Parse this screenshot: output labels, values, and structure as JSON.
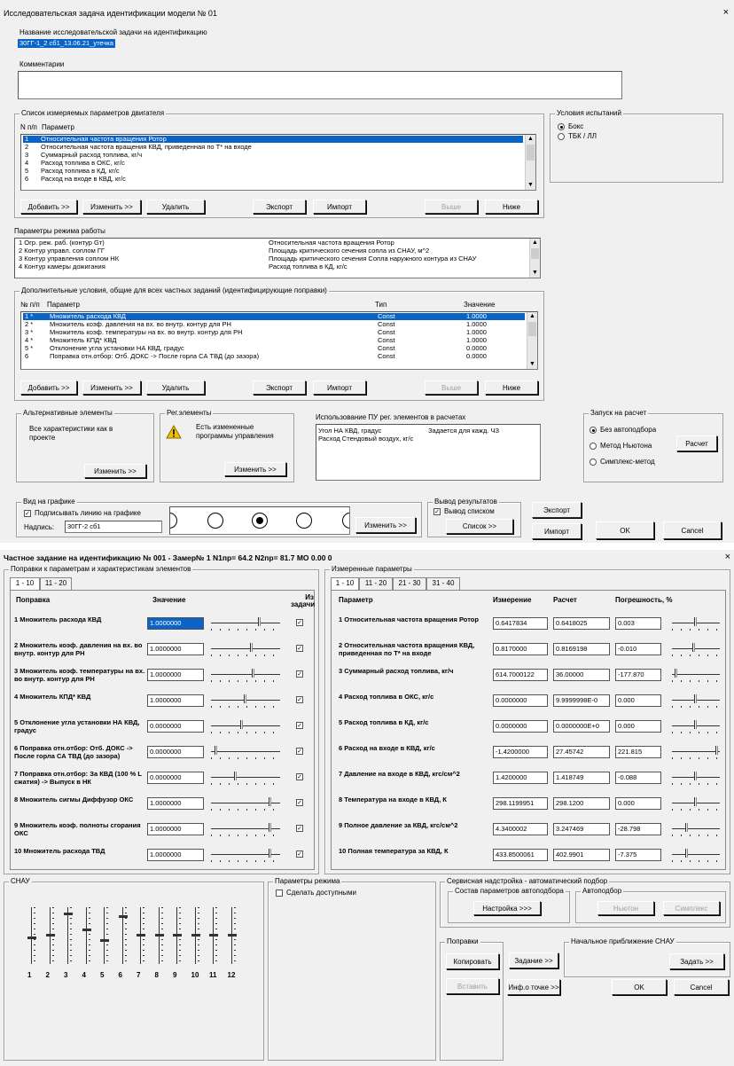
{
  "win1": {
    "title": "Исследовательская задача идентификации модели № 01",
    "close": "×",
    "name_label": "Название исследовательской задачи на идентификацию",
    "name_value": "30ГГ-1_2 сб1_13.06.21_утечка",
    "comment_label": "Комментарии",
    "params_group": "Список измеряемых параметров двигателя",
    "col_num": "N п/п",
    "col_param": "Параметр",
    "params": [
      {
        "n": "1",
        "t": "Относительная частота вращения Ротор"
      },
      {
        "n": "2",
        "t": "Относительная частота вращения КВД, приведенная по Т* на входе"
      },
      {
        "n": "3",
        "t": "Суммарный расход топлива, кг/ч"
      },
      {
        "n": "4",
        "t": "Расход топлива в ОКС, кг/с"
      },
      {
        "n": "5",
        "t": "Расход топлива в КД, кг/с"
      },
      {
        "n": "6",
        "t": "Расход на входе в КВД, кг/с"
      }
    ],
    "btn_add": "Добавить >>",
    "btn_change": "Изменить >>",
    "btn_delete": "Удалить",
    "btn_export": "Экспорт",
    "btn_import": "Импорт",
    "btn_up": "Выше",
    "btn_down": "Ниже",
    "cond_group": "Условия испытаний",
    "cond_box": "Бокс",
    "cond_tbk": "ТБК / ЛЛ",
    "mode_label": "Параметры режима работы",
    "mode_rows": [
      {
        "a": "1  Огр. реж. раб. (контур Gт)",
        "b": "Относительная частота вращения Ротор"
      },
      {
        "a": "2  Контур управл. соплом ГГ",
        "b": "Площадь критического сечения сопла из СНАУ, м^2"
      },
      {
        "a": "3  Контур управления соплом НК",
        "b": "Площадь критического сечения Сопла наружного контура из СНАУ"
      },
      {
        "a": "4  Контур камеры дожигания",
        "b": "Расход топлива в КД, кг/с"
      }
    ],
    "add_group": "Дополнительные условия, общие для всех частных заданий (идентифицирующие поправки)",
    "add_col_num": "№ п/п",
    "add_col_param": "Параметр",
    "add_col_type": "Тип",
    "add_col_val": "Значение",
    "add_rows": [
      {
        "n": "1 *",
        "p": "Множитель расхода КВД",
        "t": "Const",
        "v": "1.0000"
      },
      {
        "n": "2 *",
        "p": "Множитель коэф. давления на вх. во внутр. контур для РН",
        "t": "Const",
        "v": "1.0000"
      },
      {
        "n": "3 *",
        "p": "Множитель коэф. температуры на вх. во внутр. контур для РН",
        "t": "Const",
        "v": "1.0000"
      },
      {
        "n": "4 *",
        "p": "Множитель КПД* КВД",
        "t": "Const",
        "v": "1.0000"
      },
      {
        "n": "5 *",
        "p": "Отклонение угла установки НА КВД, градус",
        "t": "Const",
        "v": "0.0000"
      },
      {
        "n": "6",
        "p": "Поправка отн.отбор: Отб. ДОКС -> После горла СА ТВД (до зазора)",
        "t": "Const",
        "v": "0.0000"
      }
    ],
    "alt_group": "Альтернативные элементы",
    "alt_text": "Все характеристики как в проекте",
    "alt_btn": "Изменить >>",
    "reg_group": "Рег.элементы",
    "reg_text": "Есть измененные программы управления",
    "reg_btn": "Изменить >>",
    "pu_label": "Использование ПУ рег. элементов в расчетах",
    "pu_row1a": "Угол НА КВД, градус",
    "pu_row1b": "Задается для кажд. ЧЗ",
    "pu_row2": "Расход Стендовый воздух, кг/с",
    "run_group": "Запуск на расчет",
    "run_opt1": "Без автоподбора",
    "run_opt2": "Метод Ньютона",
    "run_opt3": "Симплекс-метод",
    "run_btn": "Расчет",
    "graph_group": "Вид на графике",
    "graph_chk": "Подписывать линию на графике",
    "graph_lbl": "Надпись:",
    "graph_val": "30ГГ-2 сб1",
    "graph_btn": "Изменить >>",
    "out_group": "Вывод результатов",
    "out_chk": "Вывод списком",
    "out_btn": "Список >>",
    "exp_btn": "Экспорт",
    "imp_btn": "Импорт",
    "ok_btn": "OK",
    "cancel_btn": "Cancel"
  },
  "win2": {
    "title": "Частное задание на идентификацию № 001  -  Замер№ 1 N1пр= 64.2 N2пр= 81.7 МО 0.00 0",
    "close": "×",
    "left_group": "Поправки к параметрам и характеристикам элементов",
    "tab1": "1 - 10",
    "tab2": "11 - 20",
    "col_corr": "Поправка",
    "col_val": "Значение",
    "col_task": "Из задачи",
    "corrections": [
      {
        "n": "1",
        "t": "Множитель расхода КВД",
        "v": "1.0000000"
      },
      {
        "n": "2",
        "t": "Множитель коэф. давления на вх. во внутр. контур для РН",
        "v": "1.0000000"
      },
      {
        "n": "3",
        "t": "Множитель коэф. температуры на вх. во внутр. контур для РН",
        "v": "1.0000000"
      },
      {
        "n": "4",
        "t": "Множитель КПД* КВД",
        "v": "1.0000000"
      },
      {
        "n": "5",
        "t": "Отклонение угла установки НА КВД, градус",
        "v": "0.0000000"
      },
      {
        "n": "6",
        "t": "Поправка отн.отбор: Отб. ДОКС -> После горла СА ТВД (до зазора)",
        "v": "0.0000000"
      },
      {
        "n": "7",
        "t": "Поправка отн.отбор: За КВД (100 % L сжатия) -> Выпуск в НК",
        "v": "0.0000000"
      },
      {
        "n": "8",
        "t": "Множитель сигмы Диффузор ОКС",
        "v": "1.0000000"
      },
      {
        "n": "9",
        "t": "Множитель коэф. полноты сгорания ОКС",
        "v": "1.0000000"
      },
      {
        "n": "10",
        "t": "Множитель расхода ТВД",
        "v": "1.0000000"
      }
    ],
    "right_group": "Измеренные параметры",
    "rtabs": [
      "1 - 10",
      "11 - 20",
      "21 - 30",
      "31 - 40"
    ],
    "col_param": "Параметр",
    "col_meas": "Измерение",
    "col_calc": "Расчет",
    "col_err": "Погрешность, %",
    "measured": [
      {
        "n": "1",
        "t": "Относительная частота вращения Ротор",
        "m": "0.6417834",
        "c": "0.6418025",
        "e": "0.003"
      },
      {
        "n": "2",
        "t": "Относительная частота вращения КВД, приведенная по Т* на входе",
        "m": "0.8170000",
        "c": "0.8169198",
        "e": "-0.010"
      },
      {
        "n": "3",
        "t": "Суммарный расход топлива, кг/ч",
        "m": "614.7000122",
        "c": "36.00000",
        "e": "-177.870"
      },
      {
        "n": "4",
        "t": "Расход топлива в ОКС, кг/с",
        "m": "0.0000000",
        "c": "9.9999998E-0",
        "e": "0.000"
      },
      {
        "n": "5",
        "t": "Расход топлива в КД, кг/с",
        "m": "0.0000000",
        "c": "0.0000000E+0",
        "e": "0.000"
      },
      {
        "n": "6",
        "t": "Расход на входе в КВД, кг/с",
        "m": "-1.4200000",
        "c": "27.45742",
        "e": "221.815"
      },
      {
        "n": "7",
        "t": "Давление на входе в КВД, кгс/см^2",
        "m": "1.4200000",
        "c": "1.418749",
        "e": "-0.088"
      },
      {
        "n": "8",
        "t": "Температура на входе в КВД, К",
        "m": "298.1199951",
        "c": "298.1200",
        "e": "0.000"
      },
      {
        "n": "9",
        "t": "Полное давление за КВД, кгс/см^2",
        "m": "4.3400002",
        "c": "3.247469",
        "e": "-28.798"
      },
      {
        "n": "10",
        "t": "Полная температура за КВД, К",
        "m": "433.8500061",
        "c": "402.9901",
        "e": "-7.375"
      }
    ],
    "snau_group": "СНАУ",
    "snau_nums": [
      "1",
      "2",
      "3",
      "4",
      "5",
      "6",
      "7",
      "8",
      "9",
      "10",
      "11",
      "12"
    ],
    "mode_group": "Параметры режима",
    "mode_chk": "Сделать доступными",
    "service_group": "Сервисная надстройка - автоматический подбор",
    "compose_group": "Состав параметров автоподбора",
    "setup_btn": "Настройка >>>",
    "auto_group": "Автоподбор",
    "newton_btn": "Ньютон",
    "simplex_btn": "Симплекс",
    "corr_group": "Поправки",
    "copy_btn": "Копировать",
    "paste_btn": "Вставить",
    "task_btn": "Задание >>",
    "info_btn": "Инф.о точке >>",
    "init_group": "Начальное приближение СНАУ",
    "task2_btn": "Задать >>",
    "ok_btn": "OK",
    "cancel_btn": "Cancel"
  }
}
